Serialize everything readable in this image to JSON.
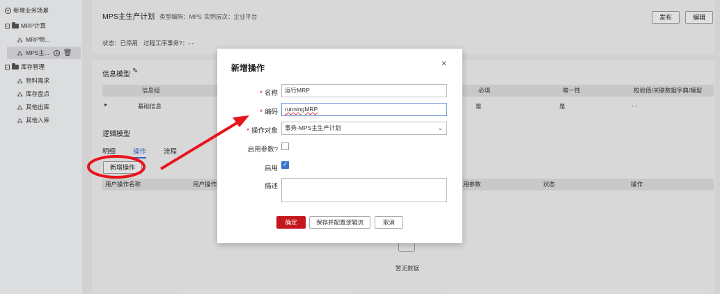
{
  "sidebar": {
    "add_scene": "新增业务场景",
    "groups": [
      {
        "label": "MRP计算",
        "items": [
          "MRP物..."
        ]
      },
      {
        "label": "MPS主...",
        "items": []
      },
      {
        "label": "库存管理",
        "items": [
          "物料需求",
          "库存盘点",
          "其他出库",
          "其他入库"
        ]
      }
    ]
  },
  "header": {
    "title": "MPS主生产计划",
    "type_code": "类型编码：MPS",
    "instance_level": "实例层次：企业平台",
    "status": "状态：已停用",
    "process_transaction": "过程工序事务?：- -",
    "publish_btn": "发布",
    "edit_btn": "编辑"
  },
  "info_model": {
    "title": "信息模型",
    "columns": [
      "信息组",
      "必填",
      "唯一性",
      "校验值/关联数据字典/模型"
    ],
    "row": {
      "name": "基础信息",
      "required": "是",
      "unique": "是",
      "validate": "- -"
    }
  },
  "logic_model": {
    "title": "逻辑模型",
    "tabs": [
      "明细",
      "操作",
      "流程"
    ],
    "add_op_btn": "新增操作",
    "columns": [
      "用户操作名称",
      "用户操作编",
      "用参数",
      "状态",
      "操作"
    ],
    "empty": "暂无数据"
  },
  "modal": {
    "title": "新增操作",
    "close": "×",
    "name_label": "名称",
    "name_value": "运行MRP",
    "code_label": "编码",
    "code_value": "runningMRP",
    "target_label": "操作对象",
    "target_value": "事务-MPS主生产计划",
    "enable_params_label": "启用参数?",
    "enable_params": false,
    "enable_label": "启用",
    "enable": true,
    "desc_label": "描述",
    "desc_value": "",
    "confirm_btn": "确定",
    "save_config_btn": "保存并配置逻辑流",
    "cancel_btn": "取消"
  },
  "colors": {
    "primary": "#c4161c",
    "annotation": "#e8141c",
    "checkbox": "#3b73c9"
  }
}
